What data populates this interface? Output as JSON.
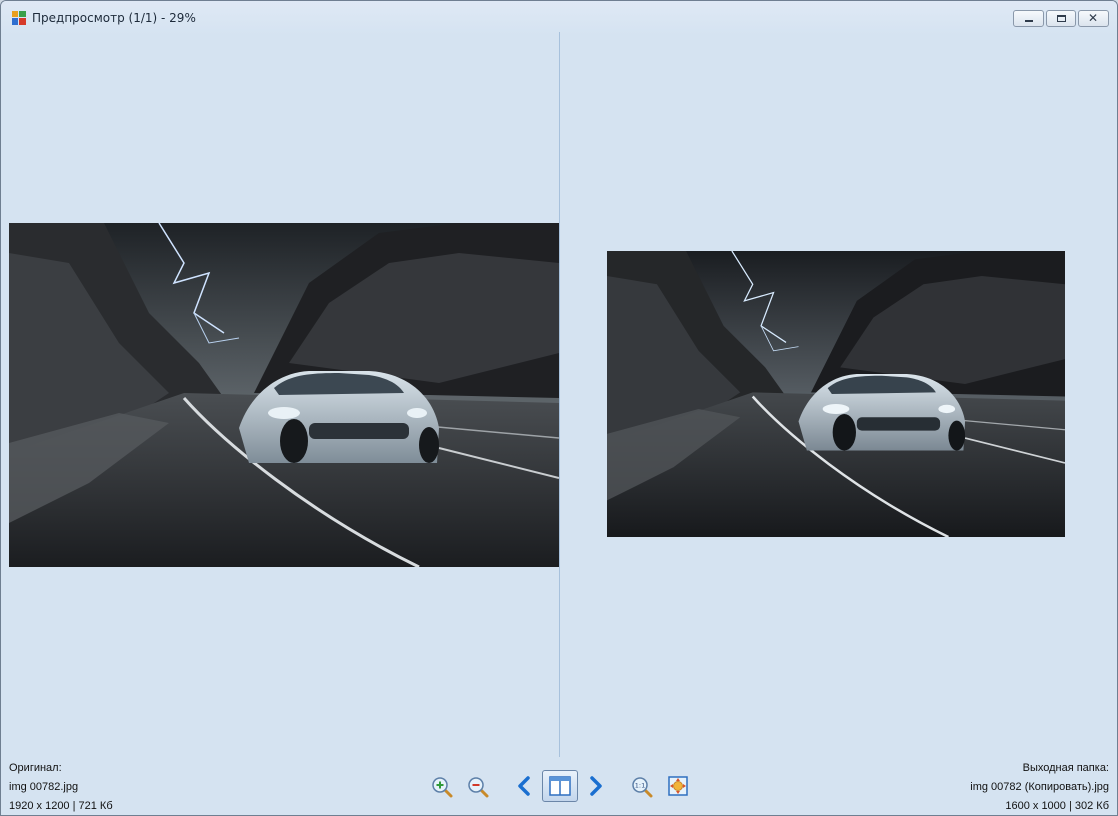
{
  "window": {
    "title": "Предпросмотр (1/1) - 29%"
  },
  "original": {
    "heading": "Оригинал:",
    "filename": "img 00782.jpg",
    "details": "1920 x 1200  |  721 Кб"
  },
  "output": {
    "heading": "Выходная папка:",
    "filename": "img 00782 (Копировать).jpg",
    "details": "1600 x 1000  |  302 Кб"
  },
  "toolbar": {
    "icons": [
      "zoom-in-icon",
      "zoom-out-icon",
      "previous-arrow-icon",
      "split-view-icon",
      "next-arrow-icon",
      "actual-size-icon",
      "fit-to-window-icon"
    ]
  },
  "colors": {
    "background": "#d5e3f1",
    "divider": "#a7c1dc",
    "accent_blue": "#1a6fd0"
  }
}
